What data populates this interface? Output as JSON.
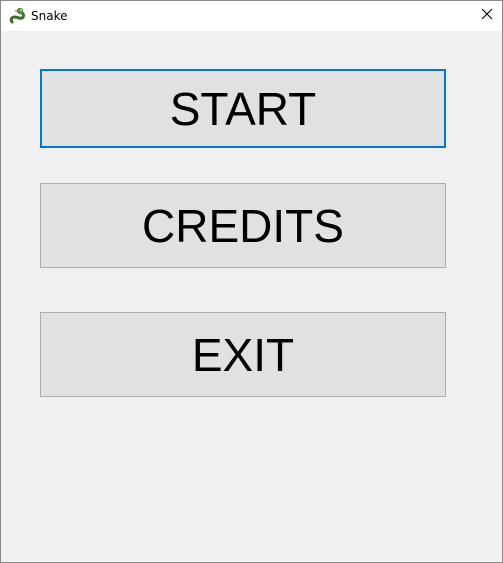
{
  "window": {
    "title": "Snake",
    "app_icon": "snake-icon",
    "close_icon": "close-icon"
  },
  "menu": {
    "start_label": "START",
    "credits_label": "CREDITS",
    "exit_label": "EXIT"
  },
  "colors": {
    "focus_border": "#0078d7",
    "button_face": "#e1e1e1",
    "window_background": "#f0f0f0"
  }
}
